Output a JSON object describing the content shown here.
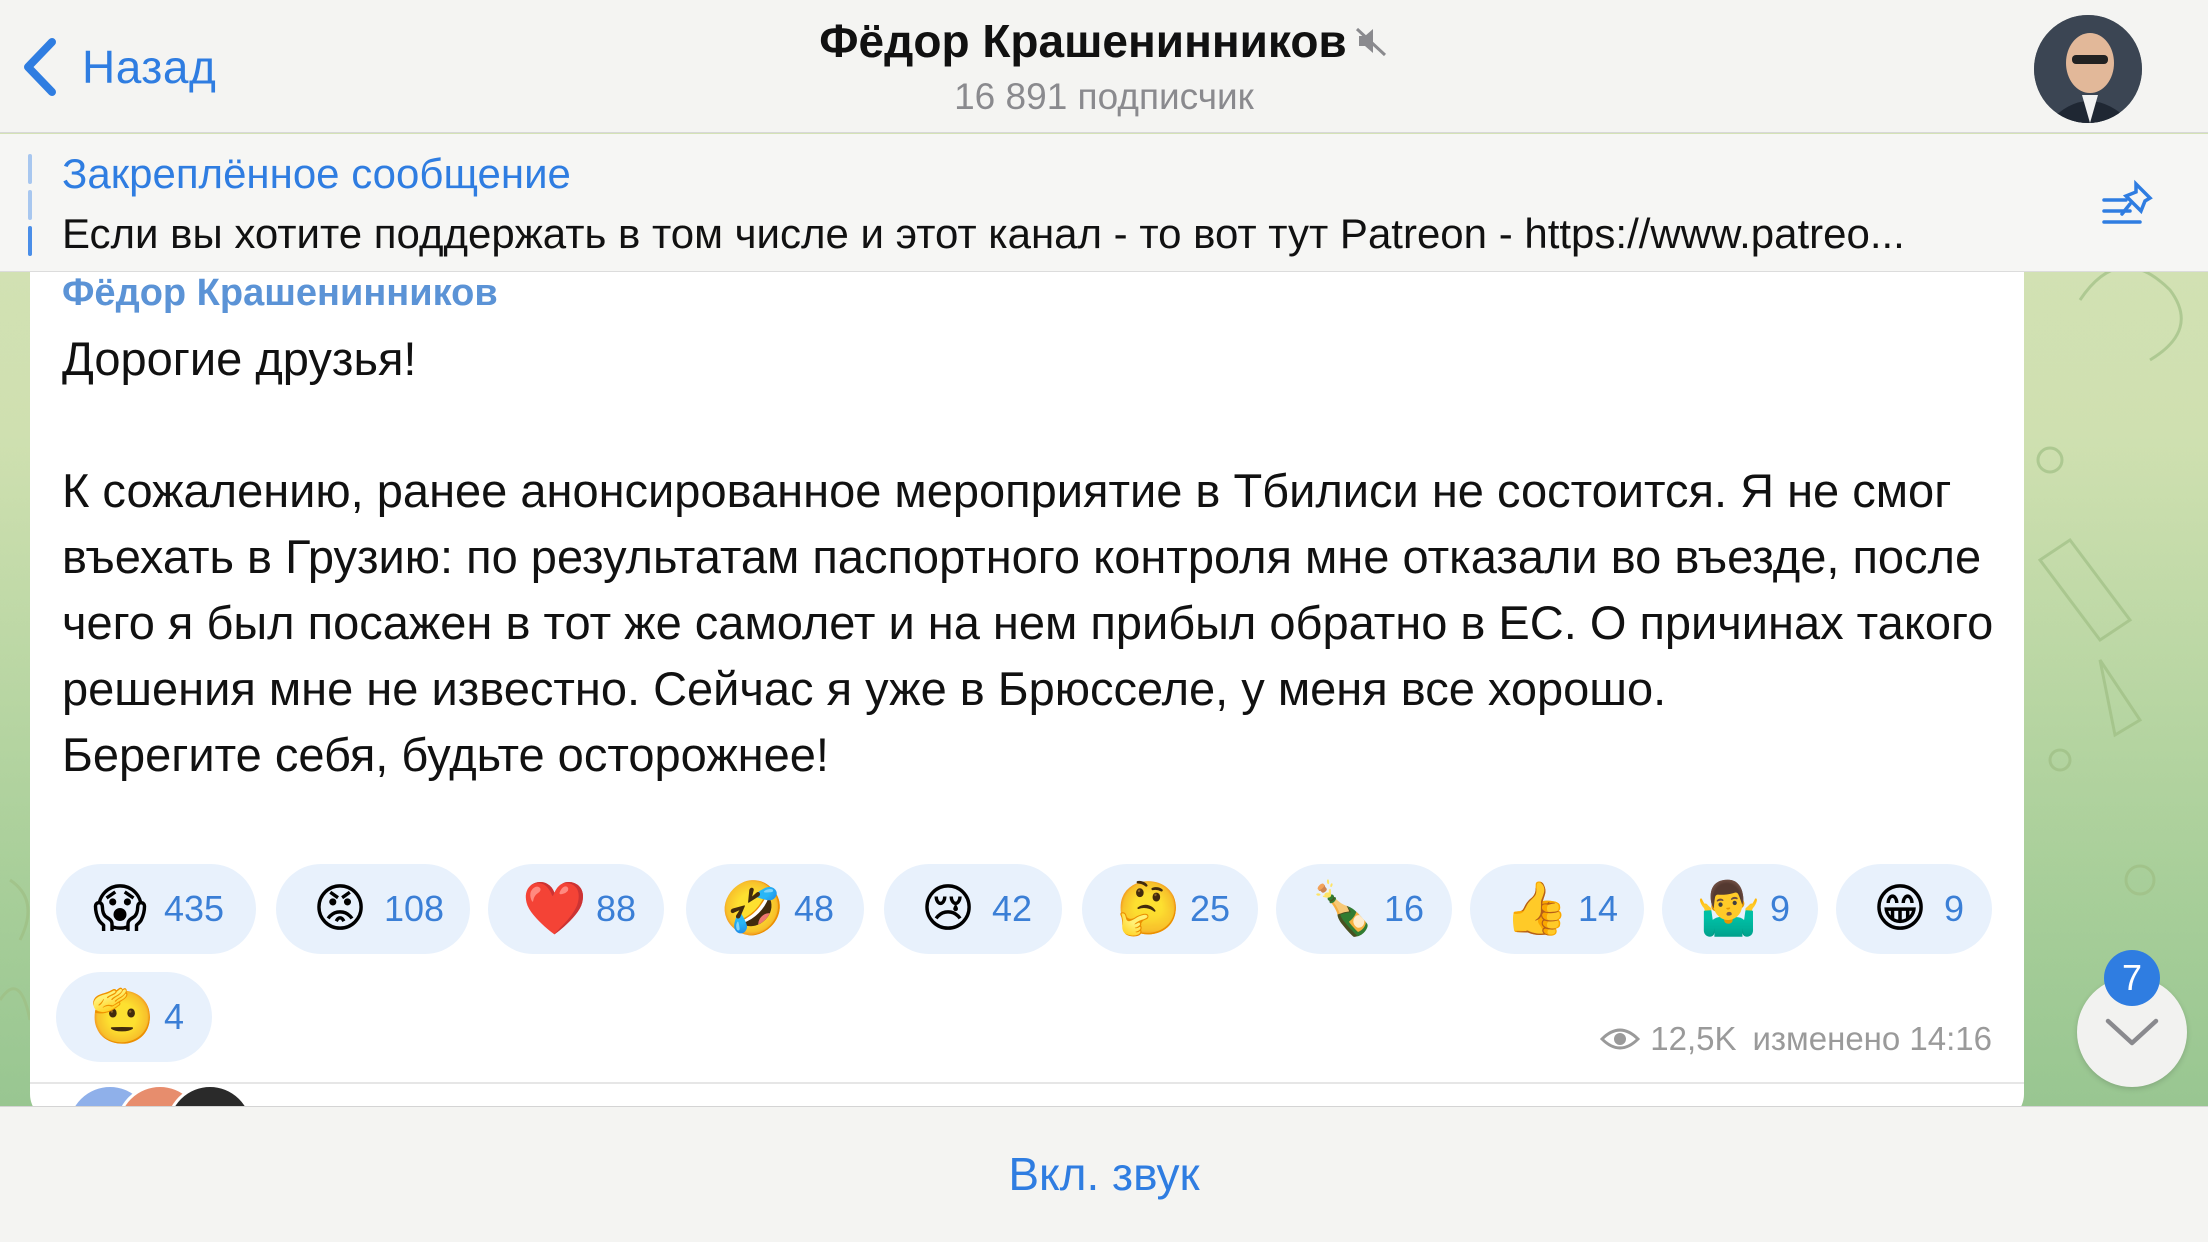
{
  "header": {
    "back_label": "Назад",
    "channel_name": "Фёдор Крашенинников",
    "subscribers": "16 891 подписчик"
  },
  "pinned": {
    "title": "Закреплённое сообщение",
    "text": "Если вы хотите поддержать в том числе и этот канал - то вот тут Patreon - https://www.patreo..."
  },
  "message": {
    "sender": "Фёдор Крашенинников",
    "text": "Дорогие друзья!\n\nК сожалению, ранее анонсированное мероприятие в Тбилиси не состоится. Я не смог въехать в Грузию: по результатам паспортного контроля мне отказали во въезде, после чего я был посажен в тот же самолет и на нем прибыл обратно в ЕС. О причинах такого решения мне не известно. Сейчас я уже в Брюсселе, у меня все хорошо.\nБерегите себя, будьте осторожнее!",
    "reactions": [
      {
        "emoji": "😱",
        "count": "435"
      },
      {
        "emoji": "😡",
        "count": "108"
      },
      {
        "emoji": "❤️",
        "count": "88"
      },
      {
        "emoji": "🤣",
        "count": "48"
      },
      {
        "emoji": "😢",
        "count": "42"
      },
      {
        "emoji": "🤔",
        "count": "25"
      },
      {
        "emoji": "🍾",
        "count": "16"
      },
      {
        "emoji": "👍",
        "count": "14"
      },
      {
        "emoji": "🤷‍♂️",
        "count": "9"
      },
      {
        "emoji": "😁",
        "count": "9"
      },
      {
        "emoji": "🫡",
        "count": "4"
      }
    ],
    "views": "12,5K",
    "edited_time": "изменено 14:16"
  },
  "scroll_down": {
    "unread_count": "7",
    "icon": "chevron-down-icon"
  },
  "bottom_bar": {
    "unmute_label": "Вкл. звук"
  },
  "colors": {
    "accent": "#2f7de1",
    "reaction_bg": "#e8f1fc",
    "sender": "#5b93d6"
  }
}
